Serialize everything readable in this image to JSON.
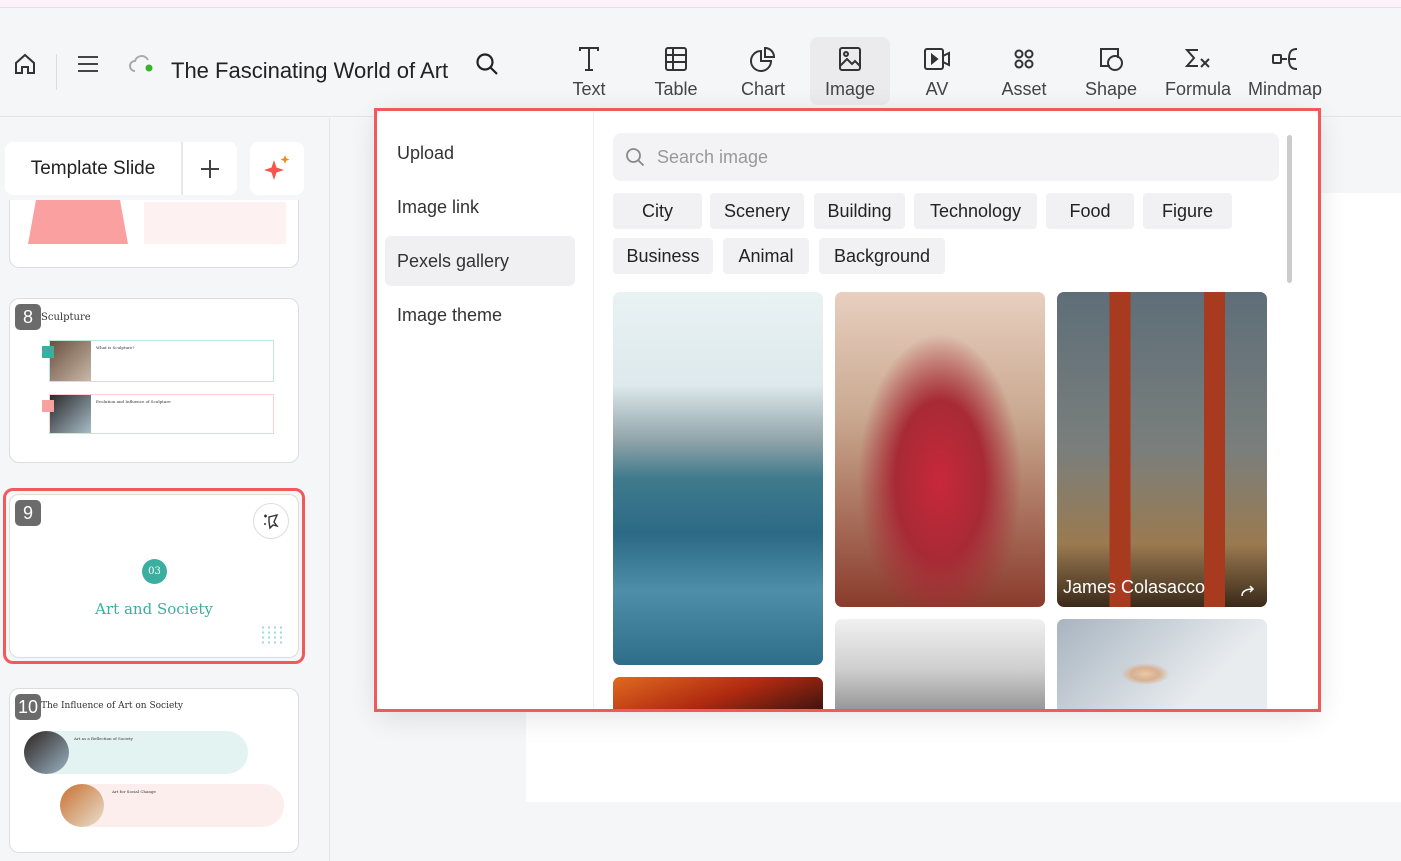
{
  "header": {
    "title": "The Fascinating World of Art"
  },
  "toolbar": [
    {
      "label": "Text",
      "icon": "text-icon"
    },
    {
      "label": "Table",
      "icon": "table-icon"
    },
    {
      "label": "Chart",
      "icon": "chart-icon"
    },
    {
      "label": "Image",
      "icon": "image-icon",
      "active": true
    },
    {
      "label": "AV",
      "icon": "video-icon"
    },
    {
      "label": "Asset",
      "icon": "asset-icon"
    },
    {
      "label": "Shape",
      "icon": "shape-icon"
    },
    {
      "label": "Formula",
      "icon": "formula-icon"
    },
    {
      "label": "Mindmap",
      "icon": "mindmap-icon"
    }
  ],
  "sidebar": {
    "template_label": "Template Slide",
    "slides": [
      {
        "number": "8",
        "title": "Sculpture",
        "items": [
          "What is Sculpture?",
          "Evolution and Influence of Sculpture"
        ]
      },
      {
        "number": "9",
        "badge": "03",
        "title": "Art and Society",
        "selected": true
      },
      {
        "number": "10",
        "title": "The Influence of Art on Society",
        "items": [
          "Art as a Reflection of Society",
          "Art for Social Change"
        ]
      }
    ]
  },
  "image_panel": {
    "menu": [
      {
        "label": "Upload"
      },
      {
        "label": "Image link"
      },
      {
        "label": "Pexels gallery",
        "active": true
      },
      {
        "label": "Image theme"
      }
    ],
    "search_placeholder": "Search image",
    "categories": [
      "City",
      "Scenery",
      "Building",
      "Technology",
      "Food",
      "Figure",
      "Business",
      "Animal",
      "Background"
    ],
    "photos": [
      {
        "credit": ""
      },
      {
        "credit": ""
      },
      {
        "credit": "James Colasacco"
      },
      {
        "credit": ""
      },
      {
        "credit": ""
      },
      {
        "credit": ""
      }
    ]
  },
  "colors": {
    "accent": "#f05a5a",
    "teal": "#3aafa0",
    "pink": "#f9a0a0"
  }
}
